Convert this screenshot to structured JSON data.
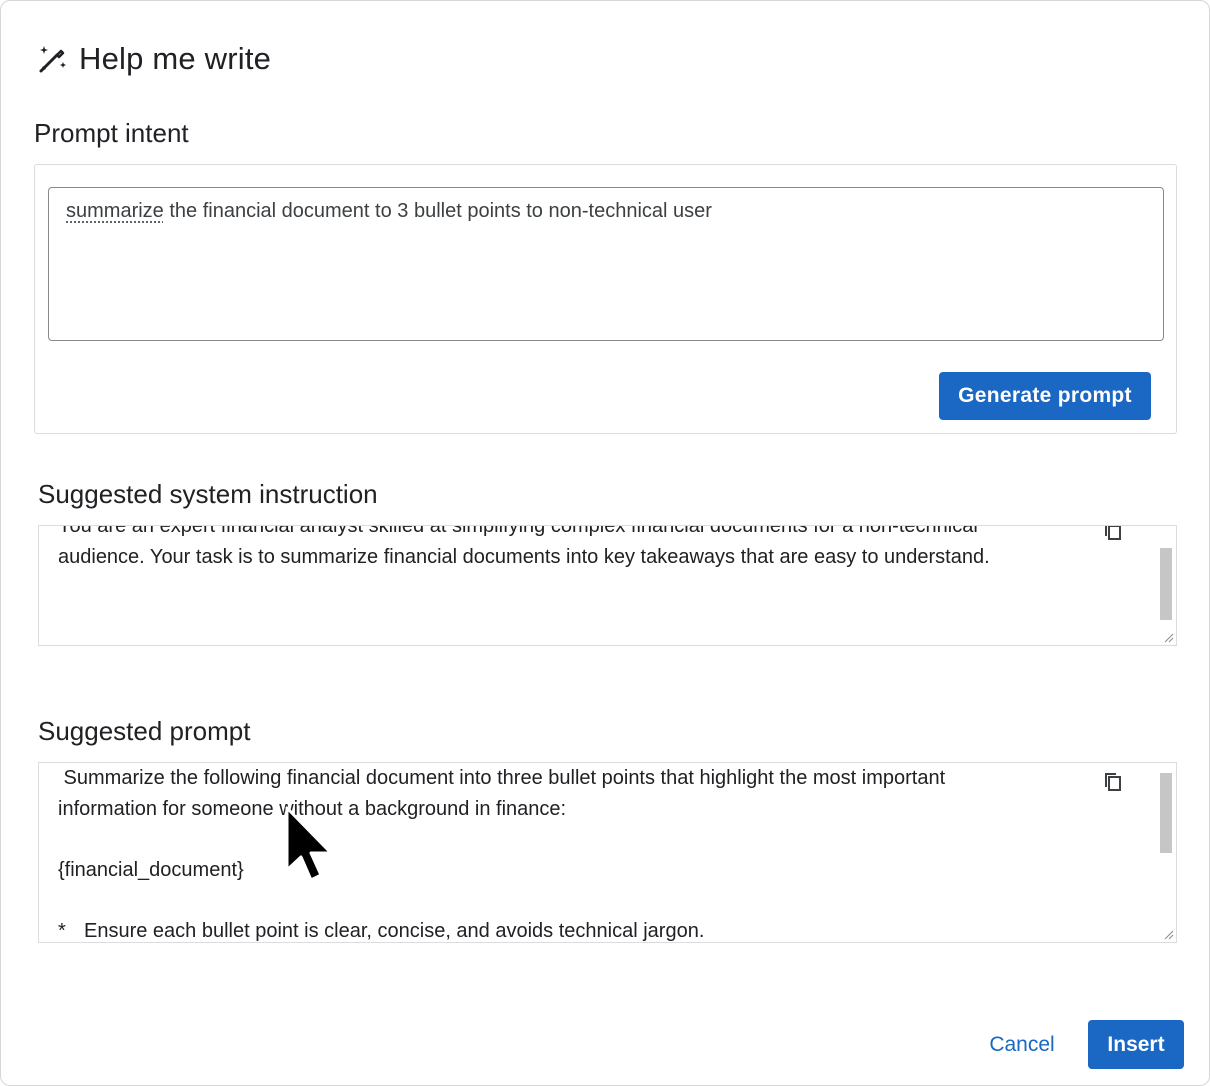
{
  "dialog": {
    "title": "Help me write",
    "title_icon": "magic-wand-pencil-icon"
  },
  "prompt_intent": {
    "label": "Prompt intent",
    "value_first_word": "summarize",
    "value_rest": " the financial document to 3 bullet points to non-technical user",
    "generate_button": "Generate prompt"
  },
  "system_instruction": {
    "label": "Suggested system instruction",
    "line1": "You are an expert financial analyst skilled at simplifying complex financial documents for a non-technical",
    "line2": "audience. Your task is to summarize financial documents into key takeaways that are easy to understand.",
    "copy_icon": "copy-icon"
  },
  "suggested_prompt": {
    "label": "Suggested prompt",
    "line1": " Summarize the following financial document into three bullet points that highlight the most important",
    "line2": "information for someone without a background in finance:",
    "line3": "{financial_document}",
    "bullet_marker": "*",
    "bullet1": "Ensure each bullet point is clear, concise, and avoids technical jargon.",
    "copy_icon": "copy-icon"
  },
  "footer": {
    "cancel_label": "Cancel",
    "insert_label": "Insert"
  },
  "colors": {
    "accent": "#1a67c4",
    "border": "#dadce0",
    "text": "#202124"
  }
}
